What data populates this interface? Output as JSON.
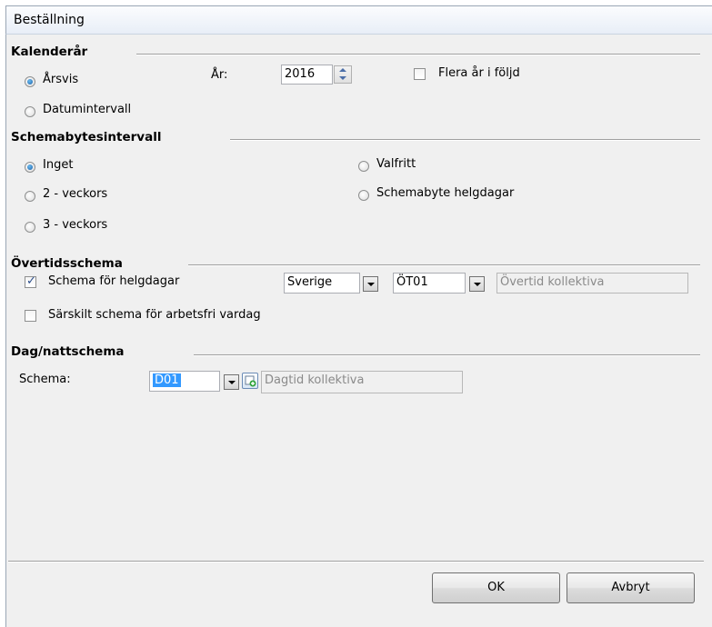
{
  "window": {
    "title": "Beställning"
  },
  "kalenderar": {
    "title": "Kalenderår",
    "mode_arsvis": "Årsvis",
    "mode_datum": "Datumintervall",
    "year_label": "År:",
    "year_value": "2016",
    "flera_ar": "Flera år i följd"
  },
  "schemabytes": {
    "title": "Schemabytesintervall",
    "opt_inget": "Inget",
    "opt_2v": "2 - veckors",
    "opt_3v": "3 - veckors",
    "opt_valfritt": "Valfritt",
    "opt_helgdagar": "Schemabyte helgdagar"
  },
  "overtid": {
    "title": "Övertidsschema",
    "helgdagar_label": "Schema för helgdagar",
    "country_value": "Sverige",
    "code_value": "ÖT01",
    "code_desc": "Övertid kollektiva",
    "sarskilt_label": "Särskilt schema för arbetsfri vardag"
  },
  "dagnatt": {
    "title": "Dag/nattschema",
    "schema_label": "Schema:",
    "schema_value": "D01",
    "schema_desc": "Dagtid kollektiva"
  },
  "buttons": {
    "ok": "OK",
    "cancel": "Avbryt"
  },
  "colors": {
    "selection": "#3399ff",
    "dialog_bg": "#f0f0f0"
  }
}
